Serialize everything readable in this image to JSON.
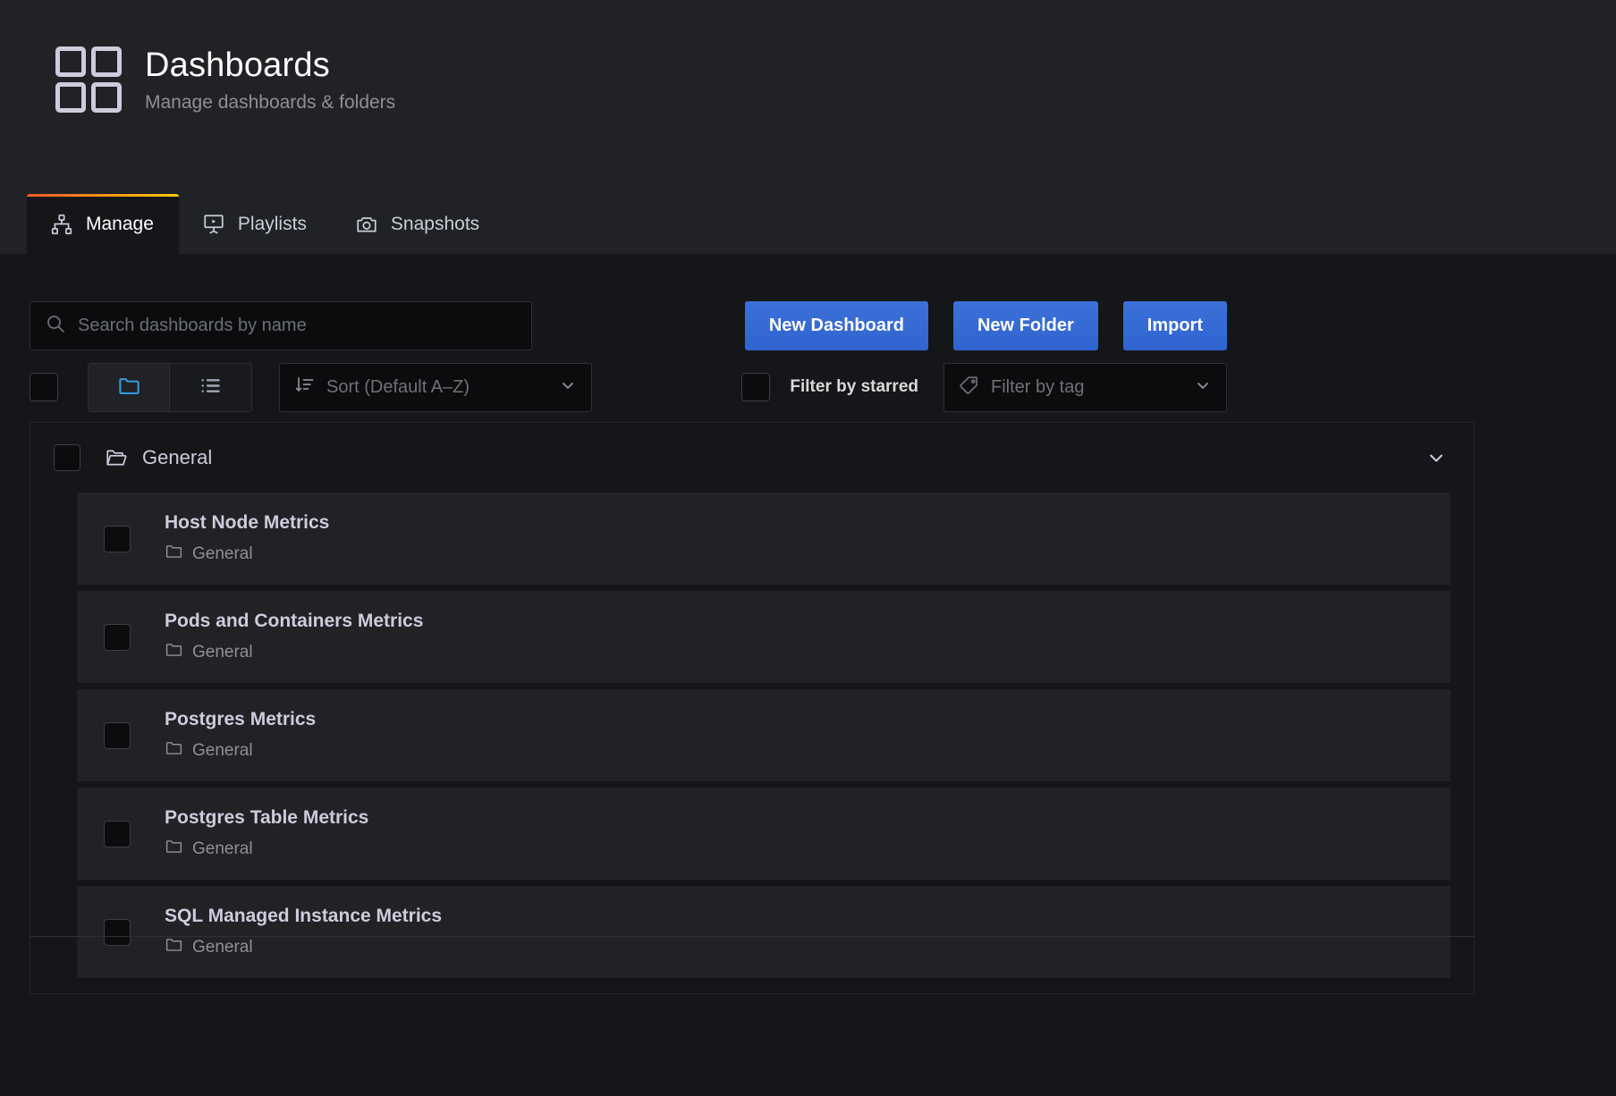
{
  "header": {
    "title": "Dashboards",
    "subtitle": "Manage dashboards & folders",
    "logo_icon": "grid-2x2-icon"
  },
  "tabs": [
    {
      "label": "Manage",
      "icon": "sitemap-icon",
      "active": true
    },
    {
      "label": "Playlists",
      "icon": "presentation-play-icon",
      "active": false
    },
    {
      "label": "Snapshots",
      "icon": "camera-icon",
      "active": false
    }
  ],
  "search": {
    "placeholder": "Search dashboards by name",
    "value": "",
    "icon": "search-icon"
  },
  "actions": {
    "new_dashboard_label": "New Dashboard",
    "new_folder_label": "New Folder",
    "import_label": "Import"
  },
  "toolbar": {
    "select_all_checked": false,
    "view_folder_icon": "folder-icon",
    "view_list_icon": "list-icon",
    "active_view": "folder",
    "sort": {
      "label": "Sort (Default A–Z)",
      "icon": "sort-amount-down-icon",
      "chevron": "chevron-down-icon"
    },
    "filter_starred_label": "Filter by starred",
    "filter_starred_checked": false,
    "filter_tag": {
      "placeholder": "Filter by tag",
      "icon": "tag-icon",
      "chevron": "chevron-down-icon"
    }
  },
  "folder_section": {
    "name": "General",
    "checked": false,
    "icon": "folder-open-icon",
    "chevron": "chevron-down-icon",
    "expanded": true
  },
  "dashboards": [
    {
      "title": "Host Node Metrics",
      "folder": "General",
      "checked": false,
      "icon": "folder-icon"
    },
    {
      "title": "Pods and Containers Metrics",
      "folder": "General",
      "checked": false,
      "icon": "folder-icon"
    },
    {
      "title": "Postgres Metrics",
      "folder": "General",
      "checked": false,
      "icon": "folder-icon"
    },
    {
      "title": "Postgres Table Metrics",
      "folder": "General",
      "checked": false,
      "icon": "folder-icon"
    },
    {
      "title": "SQL Managed Instance Metrics",
      "folder": "General",
      "checked": false,
      "icon": "folder-icon"
    }
  ],
  "colors": {
    "header_bg": "#202226",
    "page_bg": "#141619",
    "panel_item_bg": "#202226",
    "primary_button": "#3274d9",
    "accent_active_tab": "#f05a28",
    "accent_active_tab_end": "#fbca0a",
    "active_icon_blue": "#3498db",
    "text_primary": "#ccccdc",
    "text_muted": "#8e9097"
  }
}
